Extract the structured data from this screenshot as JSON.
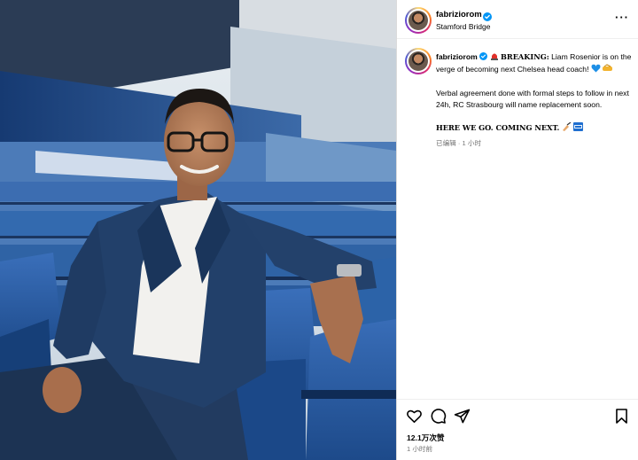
{
  "post": {
    "username": "fabriziorom",
    "location": "Stamford Bridge",
    "more_label": "···"
  },
  "caption": {
    "username": "fabriziorom",
    "breaking": "BREAKING:",
    "line1": " Liam Rosenior is on the verge of becoming next Chelsea head coach! ",
    "line2": "Verbal agreement done with formal steps to follow in next 24h, RC Strasbourg will name replacement soon.",
    "line3": "HERE WE GO. COMING NEXT.",
    "edited": "已编辑",
    "dot": " · ",
    "time": "1 小时"
  },
  "stats": {
    "likes": "12.1万次赞",
    "ago": "1 小时前"
  },
  "icons": {
    "verified": "verified-badge-icon",
    "siren": "siren-icon",
    "heart": "blue-heart-icon",
    "handshake": "handshake-icon",
    "writing": "writing-hand-icon",
    "flag": "chelsea-flag-icon",
    "like": "heart-icon",
    "comment": "comment-icon",
    "share": "share-icon",
    "save": "bookmark-icon"
  },
  "colors": {
    "verified": "#0095f6",
    "muted": "#737373",
    "seat_blue": "#2e5fa8",
    "suit_navy": "#1e3557"
  }
}
